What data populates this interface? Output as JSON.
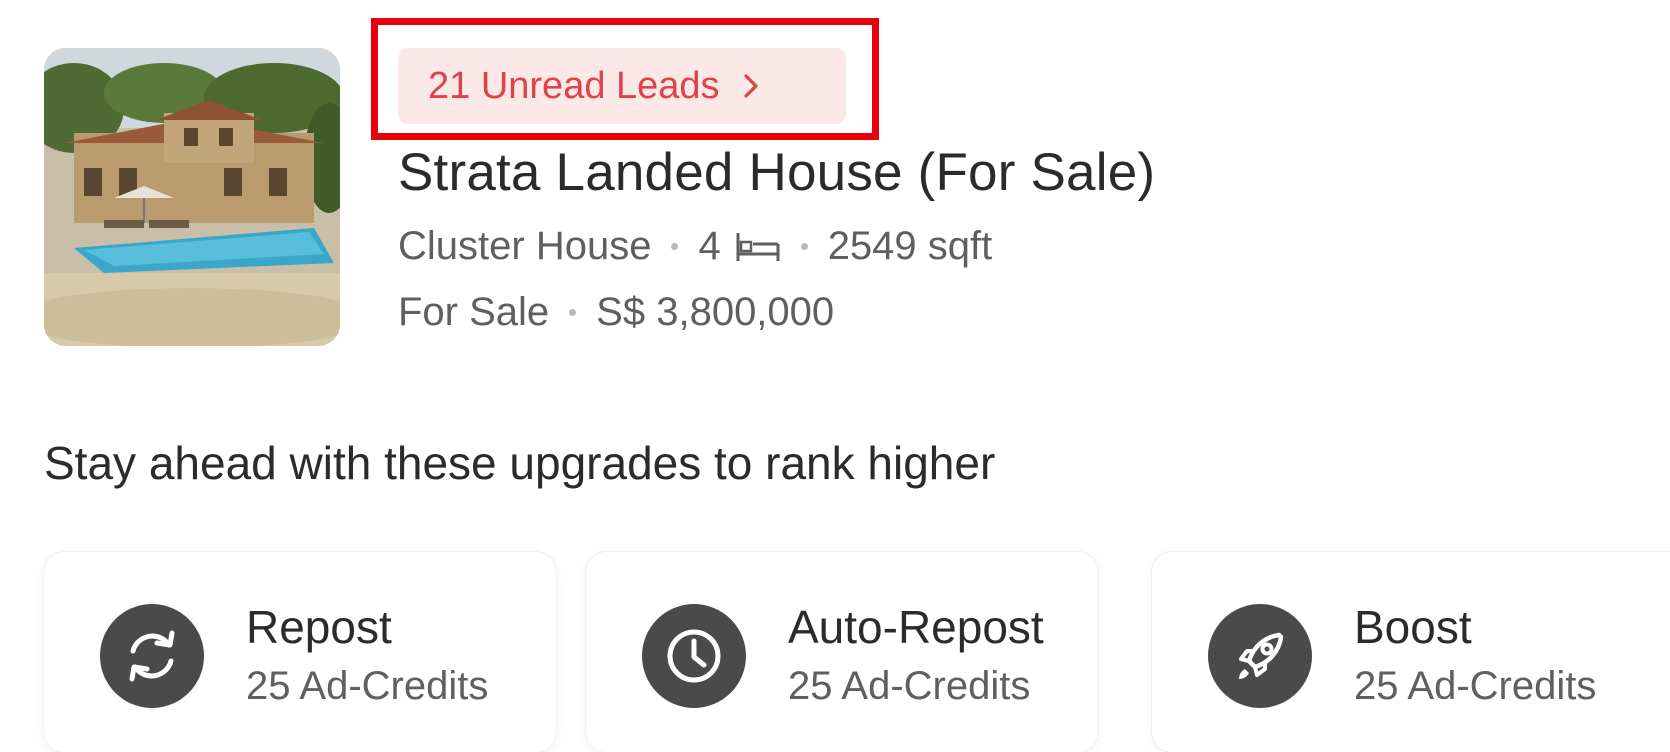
{
  "listing": {
    "leads_label": "21 Unread Leads",
    "title": "Strata Landed House (For Sale)",
    "property_type": "Cluster House",
    "bedrooms": "4",
    "area": "2549 sqft",
    "listing_type": "For Sale",
    "price": "S$ 3,800,000",
    "thumbnail_icon": "house-photo"
  },
  "upgrades": {
    "heading": "Stay ahead with these upgrades to rank higher",
    "items": [
      {
        "title": "Repost",
        "subtitle": "25 Ad-Credits",
        "icon": "refresh-icon"
      },
      {
        "title": "Auto-Repost",
        "subtitle": "25 Ad-Credits",
        "icon": "clock-icon"
      },
      {
        "title": "Boost",
        "subtitle": "25 Ad-Credits",
        "icon": "rocket-icon"
      }
    ]
  },
  "colors": {
    "highlight_border": "#e8000b",
    "leads_text": "#e0424a",
    "leads_bg": "#fde8e8",
    "icon_circle": "#4a4a4a"
  }
}
